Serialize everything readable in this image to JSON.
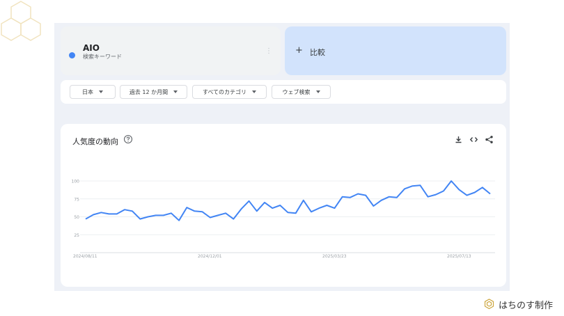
{
  "term": {
    "name": "AIO",
    "subtitle": "検索キーワード",
    "color": "#4285f4"
  },
  "compare": {
    "plus": "+",
    "label": "比較"
  },
  "filters": [
    {
      "label": "日本"
    },
    {
      "label": "過去 12 か月間"
    },
    {
      "label": "すべてのカテゴリ"
    },
    {
      "label": "ウェブ検索"
    }
  ],
  "chart": {
    "title": "人気度の動向"
  },
  "chart_data": {
    "type": "line",
    "title": "人気度の動向",
    "ylim": [
      0,
      100
    ],
    "y_ticks": [
      "100",
      "75",
      "50",
      "25"
    ],
    "x_tick_labels": [
      "2024/08/11",
      "2024/12/01",
      "2025/03/23",
      "2025/07/13"
    ],
    "grid": true,
    "series": [
      {
        "color": "#4285f4",
        "values": [
          47,
          53,
          56,
          54,
          54,
          60,
          58,
          47,
          50,
          52,
          52,
          55,
          45,
          63,
          58,
          57,
          49,
          52,
          55,
          47,
          61,
          72,
          58,
          70,
          62,
          66,
          56,
          55,
          73,
          57,
          62,
          66,
          62,
          78,
          77,
          82,
          80,
          65,
          73,
          78,
          77,
          89,
          93,
          94,
          78,
          81,
          86,
          100,
          88,
          80,
          84,
          91,
          82
        ]
      }
    ]
  },
  "brand": {
    "text": "はちのす制作"
  }
}
